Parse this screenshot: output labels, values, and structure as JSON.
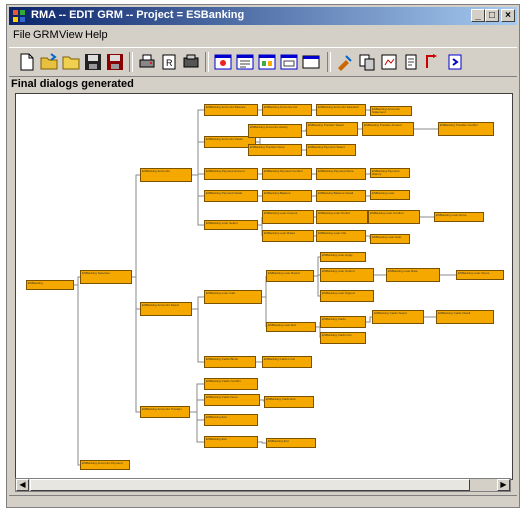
{
  "window": {
    "title": "RMA -- EDIT GRM -- Project = ESBanking"
  },
  "menu": [
    "File",
    "GRM",
    "View",
    "Help"
  ],
  "panel_label": "Final dialogs generated",
  "colors": {
    "node": "#f5a800",
    "edge": "#8a8a8a",
    "title_bar": "#0a246a"
  },
  "toolbar_icons": [
    "new-icon",
    "open-icon",
    "folder-icon",
    "save-icon",
    "save-all-icon",
    "print-icon",
    "preview-icon",
    "settings-icon",
    "view-icon-1",
    "view-icon-2",
    "view-icon-3",
    "view-icon-4",
    "window-icon",
    "tool-icon-1",
    "tool-icon-2",
    "tool-icon-3",
    "tool-icon-4",
    "tool-icon-5",
    "tool-icon-6"
  ],
  "nodes": [
    {
      "id": "n0",
      "label": "ESBanking"
    },
    {
      "id": "n1",
      "label": "ESBanking Selection"
    },
    {
      "id": "n2",
      "label": "ESBanking Accounts"
    },
    {
      "id": "n3",
      "label": "ESBanking Accounts Select"
    },
    {
      "id": "n4",
      "label": "ESBanking Accounts Transfer"
    },
    {
      "id": "n5",
      "label": "ESBanking Accounts Payment"
    },
    {
      "id": "n6",
      "label": "ESBanking Accounts Balance"
    },
    {
      "id": "n7",
      "label": "ESBanking Accounts List"
    },
    {
      "id": "n8",
      "label": "ESBanking Accounts Selected"
    },
    {
      "id": "n9",
      "label": "ESBanking Accounts Statement"
    },
    {
      "id": "n10",
      "label": "ESBanking Accounts Detail"
    },
    {
      "id": "n11",
      "label": "ESBanking Accounts History"
    },
    {
      "id": "n12",
      "label": "ESBanking Transfer Select"
    },
    {
      "id": "n13",
      "label": "ESBanking Transfer Amount"
    },
    {
      "id": "n14",
      "label": "ESBanking Transfer Confirm"
    },
    {
      "id": "n15",
      "label": "ESBanking Transfer Done"
    },
    {
      "id": "n16",
      "label": "ESBanking Payment Select"
    },
    {
      "id": "n17",
      "label": "ESBanking Payment Amount"
    },
    {
      "id": "n18",
      "label": "ESBanking Payment Confirm"
    },
    {
      "id": "n19",
      "label": "ESBanking Payment Done"
    },
    {
      "id": "n20",
      "label": "ESBanking Payment History"
    },
    {
      "id": "n21",
      "label": "ESBanking Payment Detail"
    },
    {
      "id": "n22",
      "label": "ESBanking Balance"
    },
    {
      "id": "n23",
      "label": "ESBanking Balance Detail"
    },
    {
      "id": "n24",
      "label": "ESBanking Loan"
    },
    {
      "id": "n25",
      "label": "ESBanking Loan Select"
    },
    {
      "id": "n26",
      "label": "ESBanking Loan Amount"
    },
    {
      "id": "n27",
      "label": "ESBanking Loan Period"
    },
    {
      "id": "n28",
      "label": "ESBanking Loan Confirm"
    },
    {
      "id": "n29",
      "label": "ESBanking Loan Done"
    },
    {
      "id": "n30",
      "label": "ESBanking Loan Rates"
    },
    {
      "id": "n31",
      "label": "ESBanking Loan Info"
    },
    {
      "id": "n32",
      "label": "ESBanking Loan Help"
    },
    {
      "id": "n33",
      "label": "ESBanking Loan Calc"
    },
    {
      "id": "n34",
      "label": "ESBanking Loan Result"
    },
    {
      "id": "n35",
      "label": "ESBanking Loan Apply"
    },
    {
      "id": "n36",
      "label": "ESBanking Loan Submit"
    },
    {
      "id": "n37",
      "label": "ESBanking Loan Rate"
    },
    {
      "id": "n38",
      "label": "ESBanking Loan Terms"
    },
    {
      "id": "n39",
      "label": "ESBanking Loan Signed"
    },
    {
      "id": "n40",
      "label": "ESBanking Loan Exit"
    },
    {
      "id": "n41",
      "label": "ESBanking Cards"
    },
    {
      "id": "n42",
      "label": "ESBanking Cards Select"
    },
    {
      "id": "n43",
      "label": "ESBanking Cards Detail"
    },
    {
      "id": "n44",
      "label": "ESBanking Cards Info"
    },
    {
      "id": "n45",
      "label": "ESBanking Cards Block"
    },
    {
      "id": "n46",
      "label": "ESBanking Cards Limit"
    },
    {
      "id": "n47",
      "label": "ESBanking Cards Confirm"
    },
    {
      "id": "n48",
      "label": "ESBanking Cards Done"
    },
    {
      "id": "n49",
      "label": "ESBanking Cards Exit"
    },
    {
      "id": "n50",
      "label": "ESBanking Exit"
    }
  ]
}
